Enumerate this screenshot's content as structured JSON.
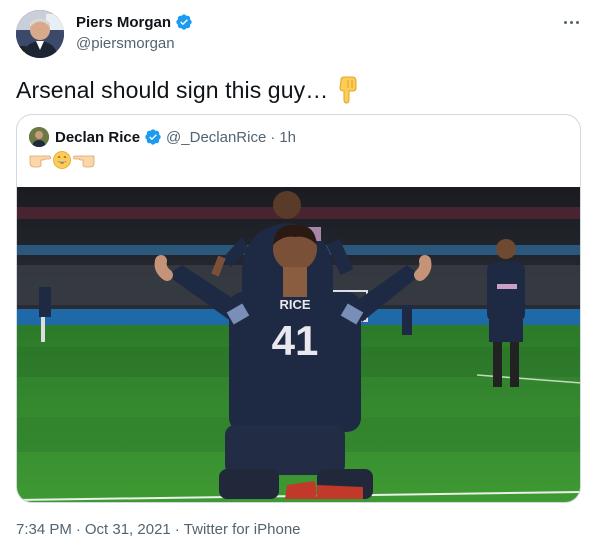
{
  "tweet": {
    "display_name": "Piers Morgan",
    "handle": "@piersmorgan",
    "text": "Arsenal should sign this guy…",
    "timestamp": "7:34 PM",
    "date": "Oct 31, 2021",
    "source": "Twitter for iPhone",
    "separator": "·"
  },
  "quoted_tweet": {
    "display_name": "Declan Rice",
    "handle": "@_DeclanRice",
    "separator": "·",
    "time": "1h",
    "photo": {
      "shirt_name": "RICE",
      "shirt_number": "41"
    }
  },
  "icons": {
    "verified": "verified-badge-icon",
    "more": "more-options-icon",
    "point_down": "backhand-index-pointing-down-icon",
    "point_right": "backhand-index-pointing-right-icon",
    "grin": "grinning-face-icon",
    "point_left": "backhand-index-pointing-left-icon"
  },
  "colors": {
    "verified_blue": "#1d9bf0",
    "text_primary": "#0f1419",
    "text_secondary": "#536471",
    "border": "#cfd9de",
    "shirt_navy": "#1e2a44",
    "pitch_green": "#2f7d2a"
  }
}
